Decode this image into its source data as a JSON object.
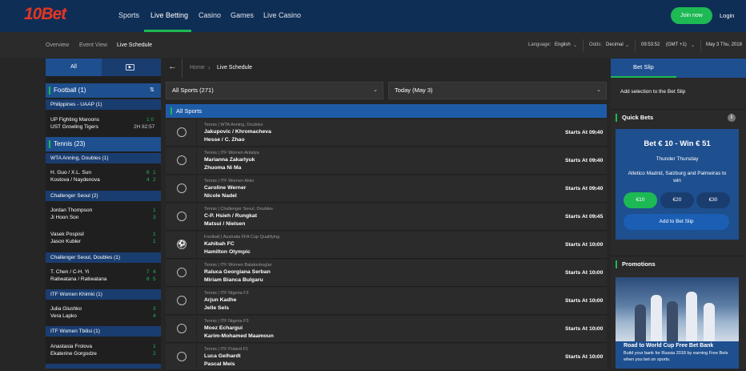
{
  "header": {
    "logo": "10Bet",
    "nav": [
      "Sports",
      "Live Betting",
      "Casino",
      "Games",
      "Live Casino"
    ],
    "join_label": "Join now",
    "login_label": "Login"
  },
  "subnav": {
    "tabs": [
      "Overview",
      "Event View",
      "Live Schedule"
    ],
    "language_label": "Language:",
    "language_value": "English",
    "odds_label": "Odds:",
    "odds_value": "Decimal",
    "time": "09:53:52",
    "timezone": "(GMT +1)",
    "date": "May 3 Thu, 2018"
  },
  "sidebar": {
    "tab_all": "All",
    "sections": [
      {
        "title": "Football (1)",
        "leagues": [
          {
            "name": "Philippines - UAAP (1)",
            "matches": [
              {
                "home": "UP Fighting Maroons",
                "away": "UST Growling Tigers",
                "score": "1 0",
                "time": "2H 82:57"
              }
            ]
          }
        ]
      },
      {
        "title": "Tennis (23)",
        "leagues": [
          {
            "name": "WTA Anning, Doubles (1)",
            "matches": [
              {
                "home": "H. Guo / X.L. Sun",
                "away": "Kostova / Naydenova",
                "h1": "6",
                "h2": "1",
                "a1": "4",
                "a2": "2"
              }
            ]
          },
          {
            "name": "Challenger Seoul (2)",
            "matches": [
              {
                "home": "Jordan Thompson",
                "away": "Ji Hoon Son",
                "h2": "1",
                "a2": "3"
              },
              {
                "home": "Vasek Pospisil",
                "away": "Jason Kubler",
                "h2": "1",
                "a2": "1"
              }
            ]
          },
          {
            "name": "Challenger Seoul, Doubles (1)",
            "matches": [
              {
                "home": "T. Chen / C-H. Yi",
                "away": "Ratiwatana / Ratiwatana",
                "h1": "7",
                "h2": "4",
                "a1": "6",
                "a2": "5"
              }
            ]
          },
          {
            "name": "ITF Women Khimki (1)",
            "matches": [
              {
                "home": "Julia Glushko",
                "away": "Vera Lapko",
                "h2": "3",
                "a2": "4"
              }
            ]
          },
          {
            "name": "ITF Women Tbilisi (1)",
            "matches": [
              {
                "home": "Anastasia Frolova",
                "away": "Ekaterine Gorgodze",
                "h2": "1",
                "a2": "2"
              }
            ]
          }
        ]
      }
    ]
  },
  "breadcrumb": {
    "home": "Home",
    "sep": "›",
    "current": "Live Schedule"
  },
  "filters": {
    "sport": "All Sports (271)",
    "day": "Today (May 3)"
  },
  "schedule": {
    "header": "All Sports",
    "events": [
      {
        "league": "Tennis | WTA Anning, Doubles",
        "home": "Jakupovic / Khromacheva",
        "away": "Hesse / C. Zhao",
        "start": "Starts At 09:40",
        "sport": "tennis"
      },
      {
        "league": "Tennis | ITF Women Antalya",
        "home": "Marianna Zakarlyuk",
        "away": "Zhuoma Ni Ma",
        "start": "Starts At 09:40",
        "sport": "tennis"
      },
      {
        "league": "Tennis | ITF Women Akko",
        "home": "Caroline Werner",
        "away": "Nicole Nadel",
        "start": "Starts At 09:40",
        "sport": "tennis"
      },
      {
        "league": "Tennis | Challenger Seoul, Doubles",
        "home": "C-P. Hsieh / Rungkat",
        "away": "Matsui / Nielsen",
        "start": "Starts At 09:45",
        "sport": "tennis"
      },
      {
        "league": "Football | Australia FFA Cup Qualifying",
        "home": "Kahibah FC",
        "away": "Hamilton Olympic",
        "start": "Starts At 10:00",
        "sport": "football"
      },
      {
        "league": "Tennis | ITF Women Balatonboglar",
        "home": "Raluca Georgiana Serban",
        "away": "Miriam Bianca Bulgaru",
        "start": "Starts At 10:00",
        "sport": "tennis"
      },
      {
        "league": "Tennis | ITF Nigeria F3",
        "home": "Arjun Kadhe",
        "away": "Jelle Sels",
        "start": "Starts At 10:00",
        "sport": "tennis"
      },
      {
        "league": "Tennis | ITF Nigeria F3",
        "home": "Moez Echargui",
        "away": "Karim-Mohamed Maamoun",
        "start": "Starts At 10:00",
        "sport": "tennis"
      },
      {
        "league": "Tennis | ITF Poland F1",
        "home": "Luca Gelhardt",
        "away": "Pascal Meis",
        "start": "Starts At 10:00",
        "sport": "tennis"
      }
    ]
  },
  "betslip": {
    "tab": "Bet Slip",
    "empty": "Add selection to the Bet Slip",
    "quick_bets_title": "Quick Bets",
    "quick_title": "Bet € 10 - Win € 51",
    "quick_sub": "Thunder Thursday",
    "quick_desc": "Atletico Madrid, Salzburg and Palmeiras to win",
    "stakes": [
      "€10",
      "€20",
      "€30"
    ],
    "add_label": "Add to Bet Slip",
    "promotions_title": "Promotions",
    "promo_title": "Road to World Cup Free Bet Bank",
    "promo_desc": "Build your bank for Russia 2018 by earning Free Bets when you bet on sports."
  },
  "colors": {
    "brand_red": "#e53524",
    "accent_green": "#1db954",
    "nav_blue": "#0f2e55",
    "section_blue": "#1e4f8f"
  }
}
